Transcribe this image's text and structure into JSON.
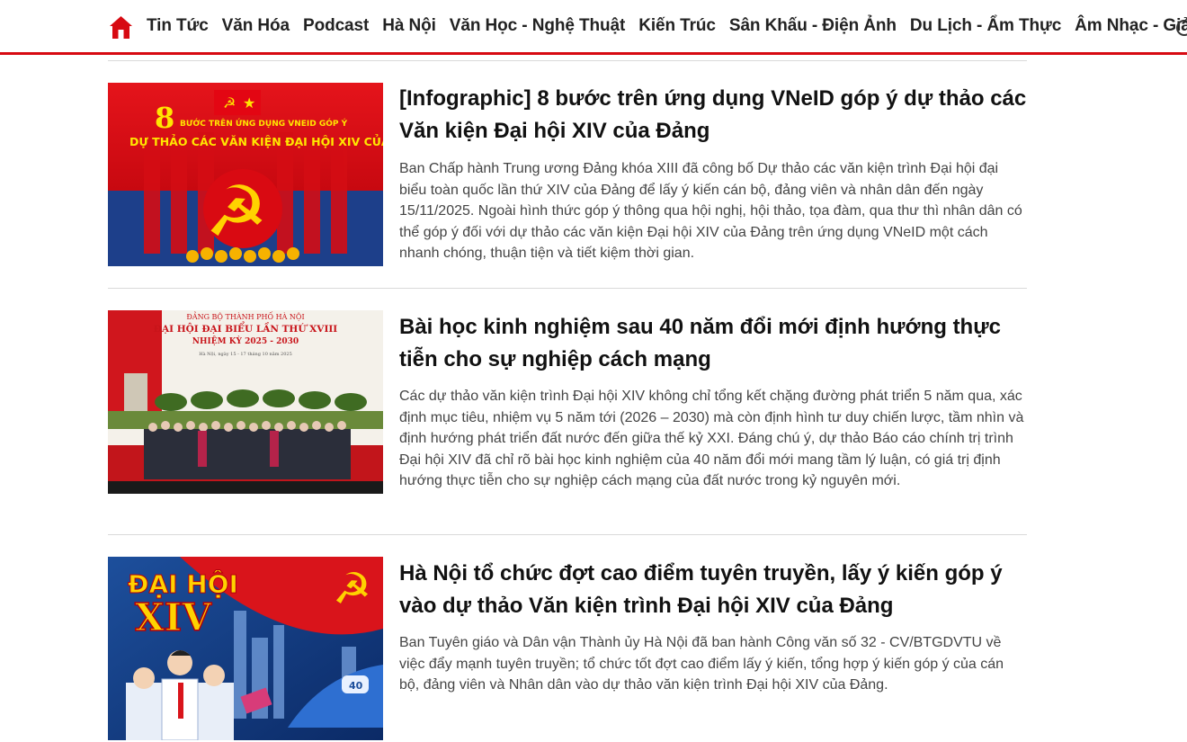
{
  "nav": {
    "items": [
      "Tin Tức",
      "Văn Hóa",
      "Podcast",
      "Hà Nội",
      "Văn Học - Nghệ Thuật",
      "Kiến Trúc",
      "Sân Khấu - Điện Ảnh",
      "Du Lịch - Ẩm Thực",
      "Âm Nhạc - Giải Trí"
    ],
    "home_icon": "home-icon",
    "accent_color": "#d70a12"
  },
  "articles": [
    {
      "title": "[Infographic] 8 bước trên ứng dụng VNeID góp ý dự thảo các Văn kiện Đại hội XIV của Đảng",
      "summary": "Ban Chấp hành Trung ương Đảng khóa XIII đã công bố Dự thảo các văn kiện trình Đại hội đại biểu toàn quốc lần thứ XIV của Đảng để lấy ý kiến cán bộ, đảng viên và nhân dân đến ngày 15/11/2025. Ngoài hình thức góp ý thông qua hội nghị, hội thảo, tọa đàm, qua thư thì nhân dân có thể góp ý đối với dự thảo các văn kiện Đại hội XIV của Đảng trên ứng dụng VNeID một cách nhanh chóng, thuận tiện và tiết kiệm thời gian.",
      "image": {
        "big_number": "8",
        "line1": "BƯỚC TRÊN ỨNG DỤNG VNEID GÓP Ý",
        "line2": "DỰ THẢO CÁC VĂN KIỆN ĐẠI HỘI XIV CỦA ĐẢNG"
      }
    },
    {
      "title": "Bài học kinh nghiệm sau 40 năm đổi mới định hướng thực tiễn cho sự nghiệp cách mạng",
      "summary": "Các dự thảo văn kiện trình Đại hội XIV không chỉ tổng kết chặng đường phát triển 5 năm qua, xác định mục tiêu, nhiệm vụ 5 năm tới (2026 – 2030) mà còn định hình tư duy chiến lược, tầm nhìn và định hướng phát triển đất nước đến giữa thế kỷ XXI. Đáng chú ý, dự thảo Báo cáo chính trị trình Đại hội XIV đã chỉ rõ bài học kinh nghiệm của 40 năm đổi mới mang tầm lý luận, có giá trị định hướng thực tiễn cho sự nghiệp cách mạng của đất nước trong kỷ nguyên mới.",
      "image": {
        "line1": "ĐẢNG BỘ THÀNH PHỐ HÀ NỘI",
        "line2": "ĐẠI HỘI ĐẠI BIỂU LẦN THỨ XVIII",
        "line3": "NHIỆM KỲ 2025 - 2030",
        "line4": "Hà Nội, ngày 15 - 17 tháng 10 năm 2025"
      }
    },
    {
      "title": "Hà Nội tổ chức đợt cao điểm tuyên truyền, lấy ý kiến góp ý vào dự thảo Văn kiện trình Đại hội XIV của Đảng",
      "summary": "Ban Tuyên giáo và Dân vận Thành ủy Hà Nội đã ban hành Công văn số 32 - CV/BTGDVTU về việc đẩy mạnh tuyên truyền; tổ chức tốt đợt cao điểm lấy ý kiến, tổng hợp ý kiến góp ý của cán bộ, đảng viên và Nhân dân vào dự thảo văn kiện trình Đại hội XIV của Đảng.",
      "image": {
        "line1": "ĐẠI HỘI",
        "line2": "XIV",
        "train_number": "40"
      }
    }
  ]
}
